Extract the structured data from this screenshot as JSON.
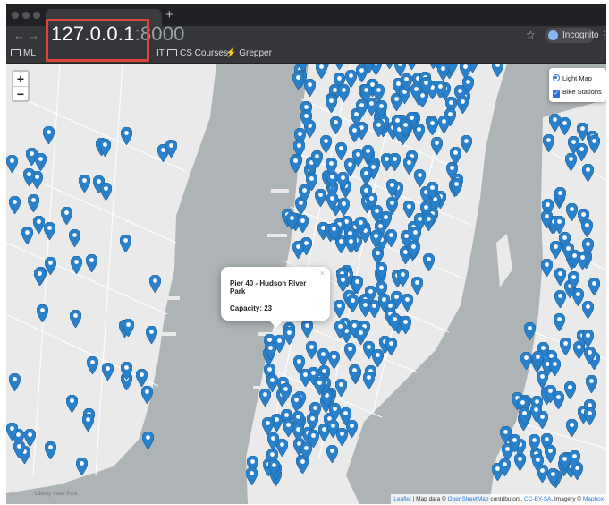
{
  "browser": {
    "url_host": "127.0.0.1",
    "url_port": ":8000",
    "profile_label": "Incognito",
    "bookmarks": [
      {
        "label": "ML",
        "type": "folder"
      },
      {
        "label": "IT",
        "type": "folder"
      },
      {
        "label": "CS Courses",
        "type": "folder"
      },
      {
        "label": "Grepper",
        "type": "link"
      }
    ]
  },
  "map": {
    "zoom_in_label": "+",
    "zoom_out_label": "−",
    "layers": {
      "base_layer_label": "Light Map",
      "base_layer_selected": true,
      "overlay_label": "Bike Stations",
      "overlay_checked": true
    },
    "popup": {
      "title": "Pier 40 - Hudson River Park",
      "capacity": "Capacity: 23",
      "close_glyph": "×"
    },
    "attribution": {
      "leaflet": "Leaflet",
      "text1": " | Map data © ",
      "osm": "OpenStreetMap",
      "text2": " contributors, ",
      "license": "CC-BY-SA",
      "text3": ", Imagery © ",
      "mapbox": "Mapbox"
    },
    "place_labels": [
      "Liberty State Park"
    ],
    "marker_color": "#2a81cb",
    "water_color": "#aeb4b6",
    "land_color": "#eaeaea"
  }
}
